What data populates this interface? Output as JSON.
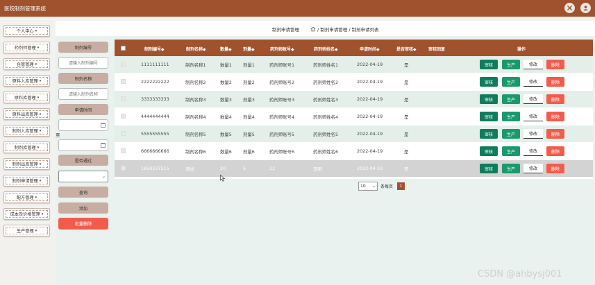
{
  "app": {
    "title": "医院制剂管理系统"
  },
  "header_icons": [
    "settings-icon",
    "user-icon"
  ],
  "sidebar": {
    "items": [
      {
        "label": "个人中心"
      },
      {
        "label": "药剂师管理"
      },
      {
        "label": "仓管管理"
      },
      {
        "label": "原料入库管理"
      },
      {
        "label": "原料库管理"
      },
      {
        "label": "原料出库管理"
      },
      {
        "label": "制剂入库管理"
      },
      {
        "label": "制剂库管理"
      },
      {
        "label": "制剂出库管理"
      },
      {
        "label": "制剂申请管理"
      },
      {
        "label": "配方管理"
      },
      {
        "label": "成本及价格管理"
      },
      {
        "label": "生产管理"
      }
    ],
    "arrow": "▾"
  },
  "breadcrumb": {
    "current": "制剂申请管理",
    "path": "/ 制剂申请管理 / 制剂申请列表"
  },
  "filters": {
    "code_label": "制剂编号",
    "code_placeholder": "请输入制剂编号",
    "name_label": "制剂名称",
    "name_placeholder": "请输入制剂名称",
    "time_label": "申请时间",
    "range_sep": "至",
    "passed_label": "是否通过",
    "query_button": "查询",
    "add_button": "添加",
    "batch_delete_button": "批量删除"
  },
  "table": {
    "headers": [
      "制剂编号◆",
      "制剂名称◆",
      "数量◆",
      "剂量◆",
      "药剂师账号◆",
      "药剂师姓名◆",
      "申请时间◆",
      "是否审核◆",
      "审核回复",
      "操作"
    ],
    "rows": [
      {
        "code": "1111111111",
        "name": "制剂名称1",
        "qty": "数量1",
        "dose": "剂量1",
        "acct": "药剂师账号1",
        "pharm": "药剂师姓名1",
        "date": "2022-04-19",
        "audited": "是",
        "reply": ""
      },
      {
        "code": "2222222222",
        "name": "制剂名称2",
        "qty": "数量2",
        "dose": "剂量2",
        "acct": "药剂师账号2",
        "pharm": "药剂师姓名2",
        "date": "2022-04-19",
        "audited": "是",
        "reply": ""
      },
      {
        "code": "3333333333",
        "name": "制剂名称3",
        "qty": "数量3",
        "dose": "剂量3",
        "acct": "药剂师账号3",
        "pharm": "药剂师姓名3",
        "date": "2022-04-19",
        "audited": "是",
        "reply": ""
      },
      {
        "code": "4444444444",
        "name": "制剂名称4",
        "qty": "数量4",
        "dose": "剂量4",
        "acct": "药剂师账号4",
        "pharm": "药剂师姓名4",
        "date": "2022-04-19",
        "audited": "是",
        "reply": ""
      },
      {
        "code": "5555555555",
        "name": "制剂名称5",
        "qty": "数量5",
        "dose": "剂量5",
        "acct": "药剂师账号5",
        "pharm": "药剂师姓名5",
        "date": "2022-04-19",
        "audited": "是",
        "reply": ""
      },
      {
        "code": "6666666666",
        "name": "制剂名称6",
        "qty": "数量6",
        "dose": "剂量6",
        "acct": "药剂师账号6",
        "pharm": "药剂师姓名6",
        "date": "2022-04-19",
        "audited": "是",
        "reply": ""
      },
      {
        "code": "1650337515",
        "name": "测试",
        "qty": "20",
        "dose": "5",
        "acct": "22",
        "pharm": "李明",
        "date": "2022-04-19",
        "audited": "否",
        "reply": ""
      }
    ],
    "actions": {
      "audit": "审核",
      "produce": "生产",
      "edit": "修改",
      "delete": "删除"
    }
  },
  "pagination": {
    "page_size": "10",
    "page_size_label": "条每页",
    "current_page": "1"
  },
  "watermark": "CSDN @ahbysj001",
  "colors": {
    "brand": "#a0522d",
    "filter_label": "#c8ada3",
    "danger": "#f25c4d",
    "green_dark": "#0f7d5c",
    "green": "#1a9a6c",
    "row_alt": "#e5efe9"
  }
}
